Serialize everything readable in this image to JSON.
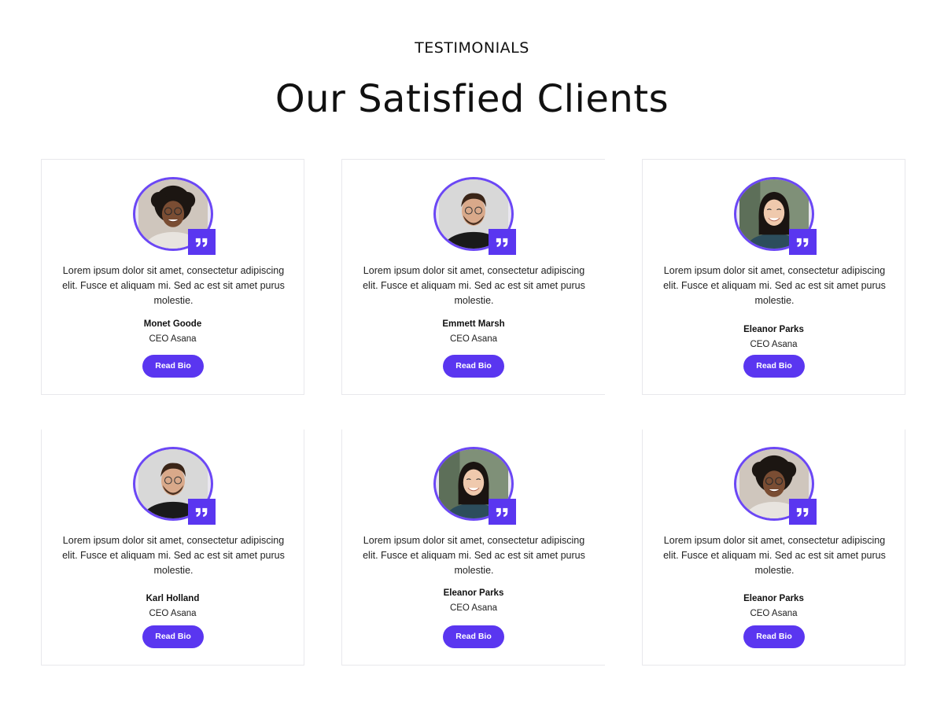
{
  "section": {
    "eyebrow": "TESTIMONIALS",
    "title": "Our Satisfied Clients"
  },
  "colors": {
    "accent": "#5a36f0",
    "avatar_ring": "#6b47f5"
  },
  "testimonials": [
    {
      "quote": "Lorem ipsum dolor sit amet, consectetur adipiscing elit. Fusce et aliquam mi. Sed ac est sit amet purus molestie.",
      "name": "Monet Goode",
      "role": "CEO Asana",
      "button_label": "Read Bio",
      "badge_icon": "quote-icon"
    },
    {
      "quote": "Lorem ipsum dolor sit amet, consectetur adipiscing elit. Fusce et aliquam mi. Sed ac est sit amet purus molestie.",
      "name": "Emmett Marsh",
      "role": "CEO Asana",
      "button_label": "Read Bio",
      "badge_icon": "quote-icon"
    },
    {
      "quote": "Lorem ipsum dolor sit amet, consectetur adipiscing elit. Fusce et aliquam mi. Sed ac est sit amet purus molestie.",
      "name": "Eleanor Parks",
      "role": "CEO Asana",
      "button_label": "Read Bio",
      "badge_icon": "quote-icon"
    },
    {
      "quote": "Lorem ipsum dolor sit amet, consectetur adipiscing elit. Fusce et aliquam mi. Sed ac est sit amet purus molestie.",
      "name": "Karl Holland",
      "role": "CEO Asana",
      "button_label": "Read Bio",
      "badge_icon": "quote-icon"
    },
    {
      "quote": "Lorem ipsum dolor sit amet, consectetur adipiscing elit. Fusce et aliquam mi. Sed ac est sit amet purus molestie.",
      "name": "Eleanor Parks",
      "role": "CEO Asana",
      "button_label": "Read Bio",
      "badge_icon": "quote-icon"
    },
    {
      "quote": "Lorem ipsum dolor sit amet, consectetur adipiscing elit. Fusce et aliquam mi. Sed ac est sit amet purus molestie.",
      "name": "Eleanor Parks",
      "role": "CEO Asana",
      "button_label": "Read Bio",
      "badge_icon": "quote-icon"
    }
  ]
}
